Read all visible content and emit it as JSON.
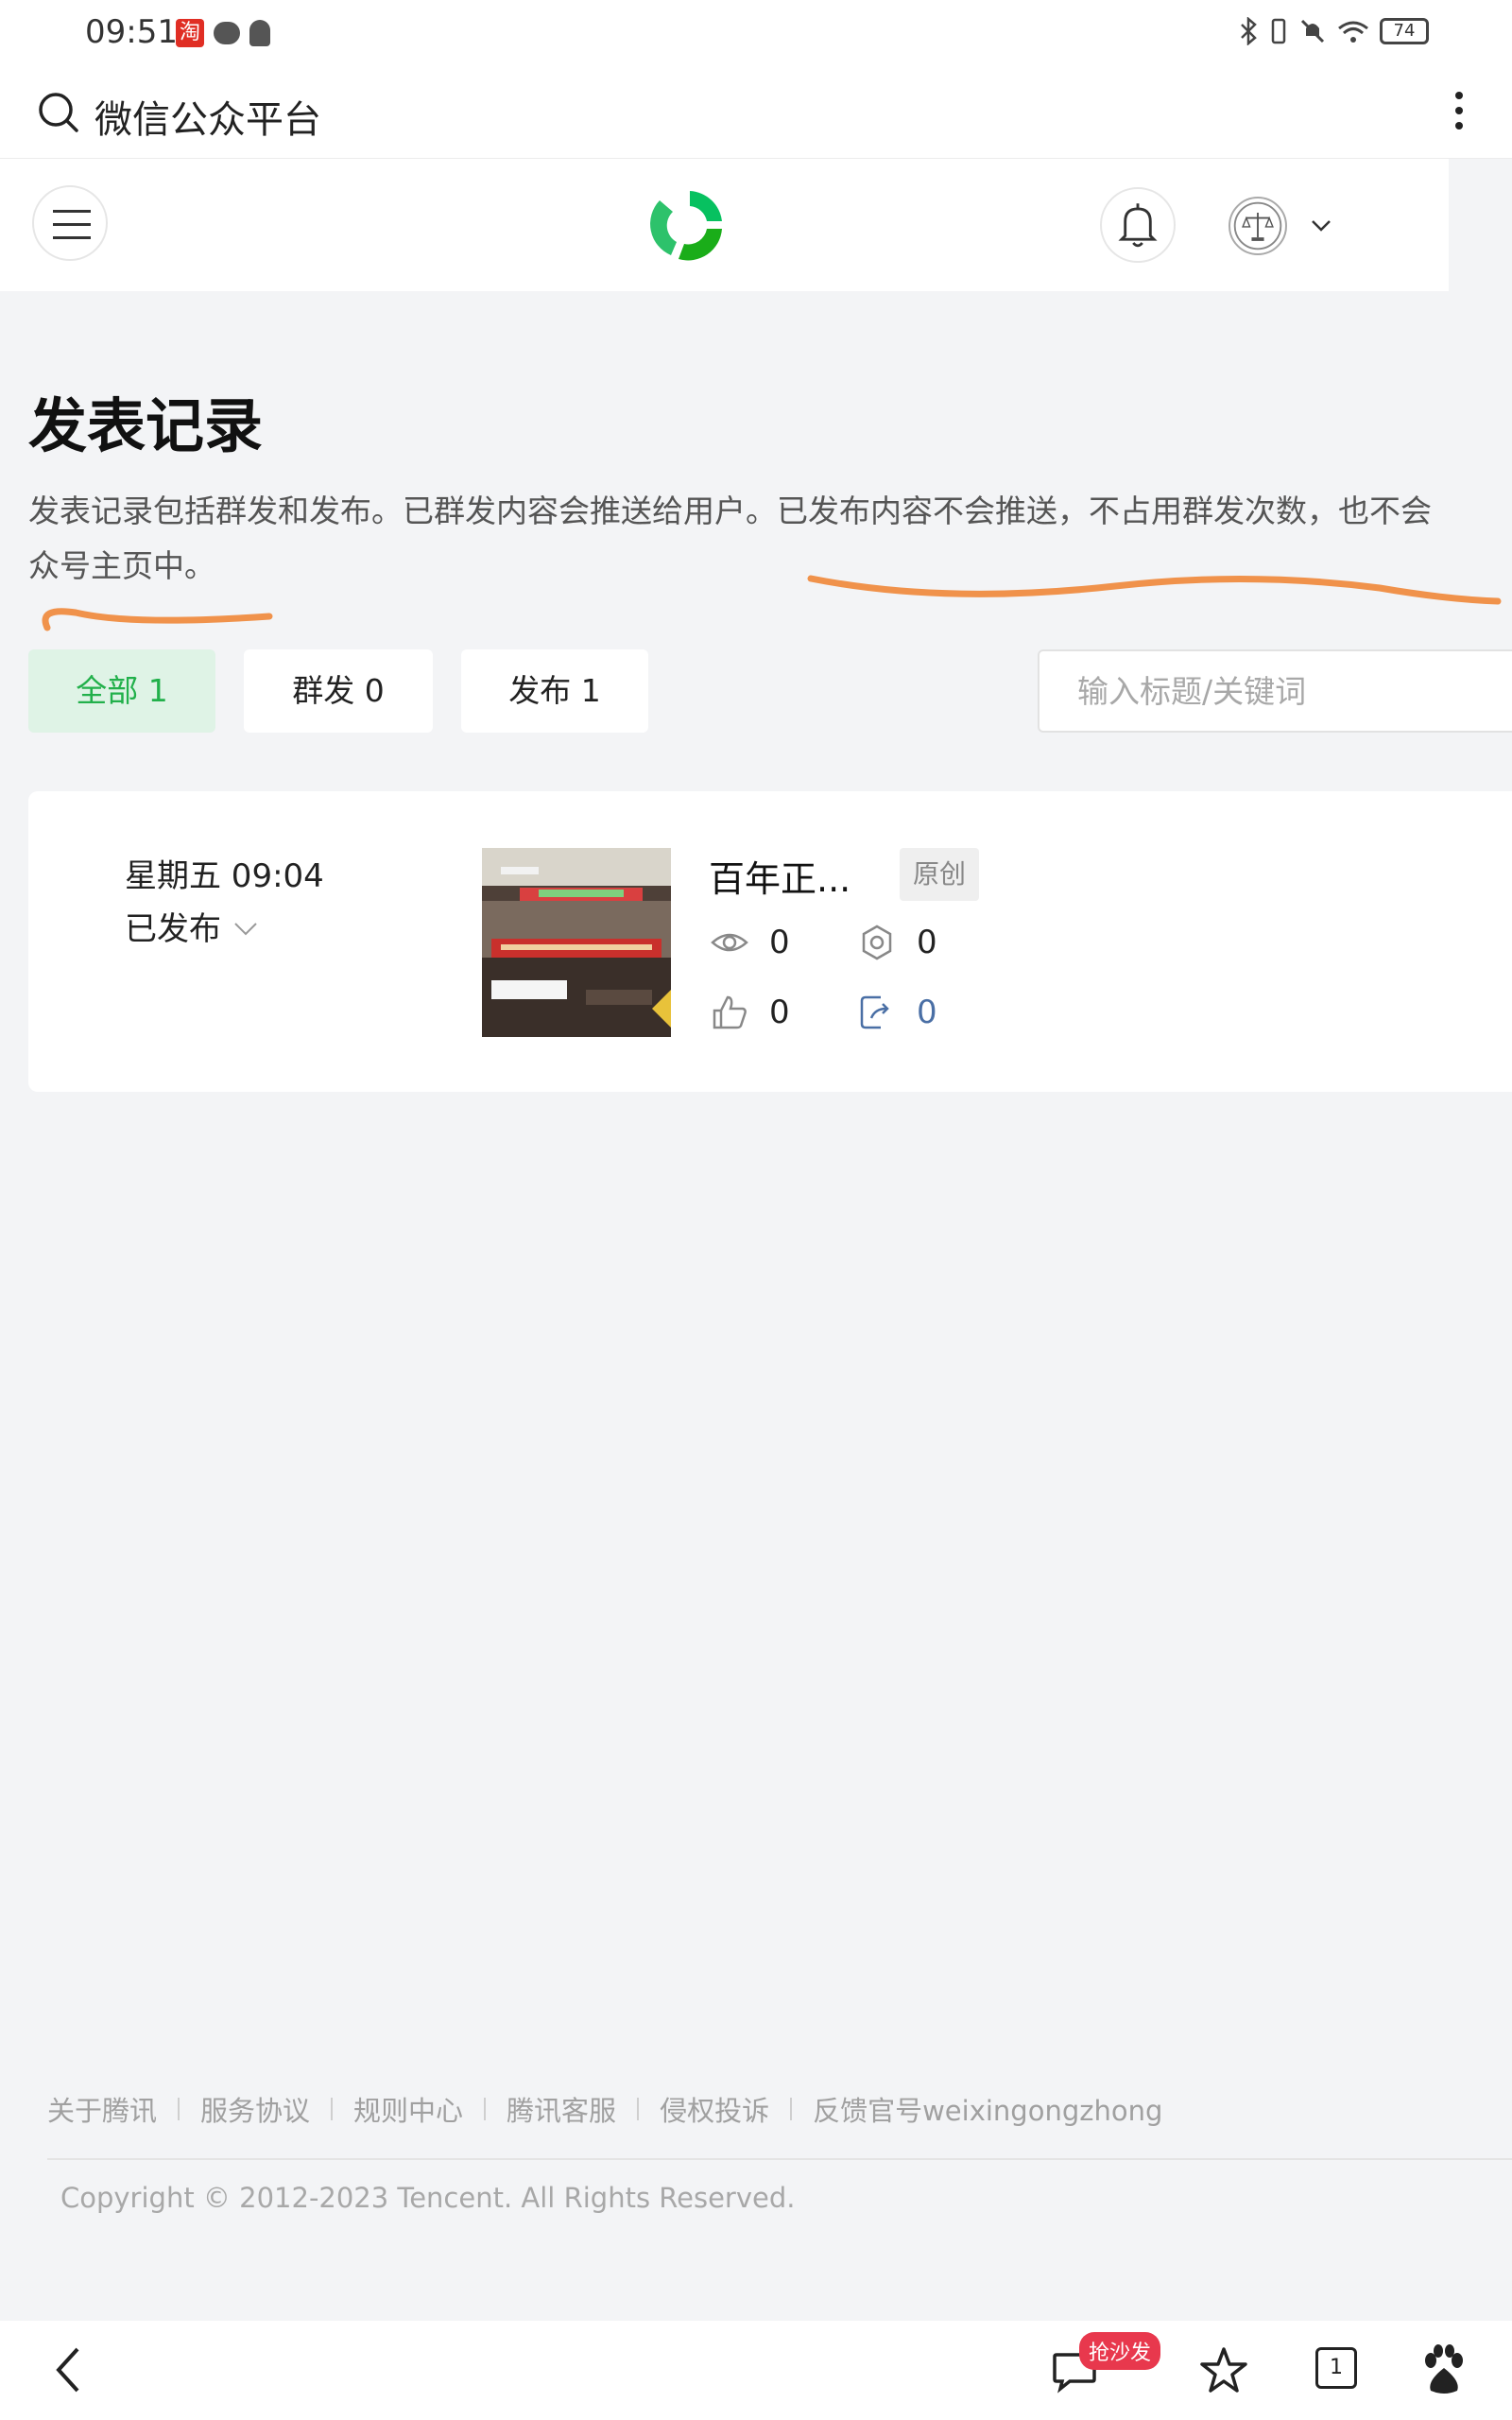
{
  "status_bar": {
    "time": "09:51",
    "taobao_glyph": "淘",
    "battery": "74",
    "icons": [
      "taobao-icon",
      "wechat-icon",
      "qq-icon",
      "bluetooth-icon",
      "vibrate-icon",
      "mute-icon",
      "wifi-icon",
      "battery-icon"
    ]
  },
  "browser": {
    "title": "微信公众平台"
  },
  "page": {
    "title": "发表记录",
    "description_line1": "发表记录包括群发和发布。已群发内容会推送给用户。已发布内容不会推送，不占用群发次数，也不会",
    "description_line2": "众号主页中。",
    "annotation_color": "#f0924b"
  },
  "tabs": [
    {
      "label": "全部 1",
      "active": true
    },
    {
      "label": "群发 0",
      "active": false
    },
    {
      "label": "发布 1",
      "active": false
    }
  ],
  "search": {
    "placeholder": "输入标题/关键词",
    "value": ""
  },
  "record": {
    "time": "星期五 09:04",
    "status": "已发布",
    "title": "百年正...",
    "badge": "原创",
    "reads": "0",
    "shares": "0",
    "likes": "0",
    "forwards": "0"
  },
  "footer": {
    "links": [
      "关于腾讯",
      "服务协议",
      "规则中心",
      "腾讯客服",
      "侵权投诉",
      "反馈官号weixingongzhong"
    ],
    "copyright": "Copyright © 2012-2023 Tencent. All Rights Reserved."
  },
  "bottom_bar": {
    "comment_badge": "抢沙发",
    "tab_count": "1"
  },
  "colors": {
    "accent_green": "#22b04b",
    "active_tab_bg": "#dff3e6",
    "badge_red": "#e8384d"
  }
}
